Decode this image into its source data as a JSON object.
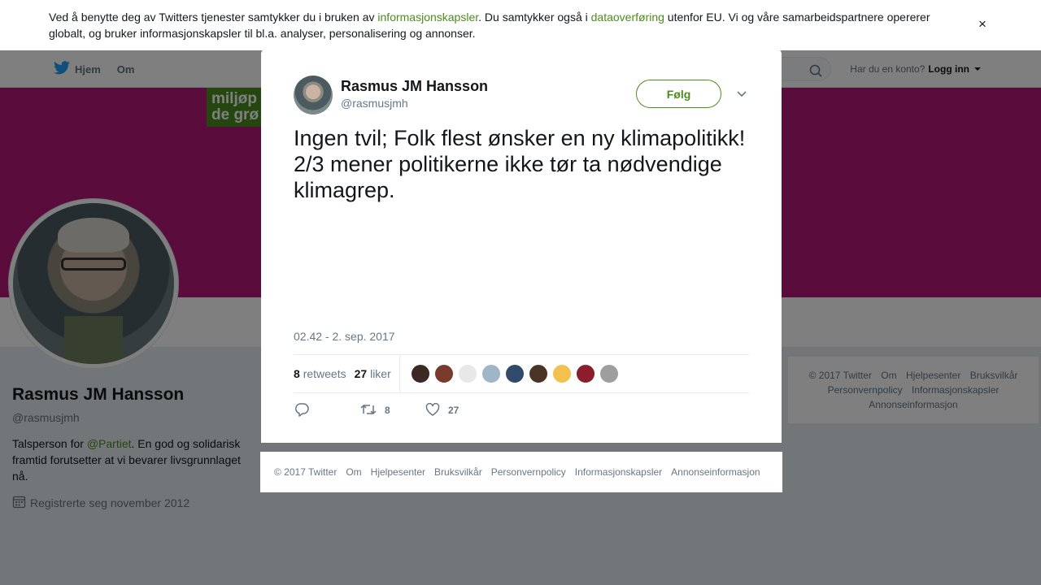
{
  "cookie_banner": {
    "text_1": "Ved å benytte deg av Twitters tjenester samtykker du i bruken av ",
    "link_1": "informasjonskapsler",
    "text_2": ". Du samtykker også i ",
    "link_2": "dataoverføring",
    "text_3": " utenfor EU. Vi og våre samarbeidspartnere opererer globalt, og bruker informasjonskapsler til bl.a. analyser, personalisering og annonser.",
    "close": "×"
  },
  "topnav": {
    "home": "Hjem",
    "about": "Om",
    "account_prompt": "Har du en konto?",
    "login": "Logg inn"
  },
  "banner": {
    "logo_line1": "miljøp",
    "logo_line2": "de grø"
  },
  "profile": {
    "name": "Rasmus JM Hansson",
    "handle": "@rasmusjmh",
    "bio_1": "Talsperson for ",
    "bio_link": "@Partiet",
    "bio_2": ". En god og solidarisk framtid forutsetter at vi bevarer livsgrunnlaget nå.",
    "joined": "Registrerte seg november 2012"
  },
  "sidebar_footer": {
    "items": [
      "© 2017 Twitter",
      "Om",
      "Hjelpesenter",
      "Bruksvilkår",
      "Personvernpolicy",
      "Informasjonskapsler",
      "Annonseinformasjon"
    ]
  },
  "tweet": {
    "author_name": "Rasmus JM Hansson",
    "author_handle": "@rasmusjmh",
    "follow_label": "Følg",
    "text": "Ingen tvil; Folk flest ønsker en ny klimapolitikk! 2/3 mener politikerne ikke tør ta nødvendige klimagrep.",
    "timestamp": "02.42 - 2. sep. 2017",
    "retweet_count": "8",
    "retweet_label": "retweets",
    "like_count": "27",
    "like_label": "liker",
    "action_retweets": "8",
    "action_likes": "27",
    "liker_colors": [
      "#3b2a24",
      "#7a3b2e",
      "#e8e8e8",
      "#9fb6c7",
      "#2f4a6b",
      "#4a3428",
      "#f2c14e",
      "#8b1d2c",
      "#9e9e9e"
    ]
  },
  "modal_footer": {
    "items": [
      "© 2017 Twitter",
      "Om",
      "Hjelpesenter",
      "Bruksvilkår",
      "Personvernpolicy",
      "Informasjonskapsler",
      "Annonseinformasjon"
    ]
  },
  "colors": {
    "accent": "#4c8c1f",
    "banner": "#b51a78",
    "text": "#14171a",
    "muted": "#657786"
  }
}
